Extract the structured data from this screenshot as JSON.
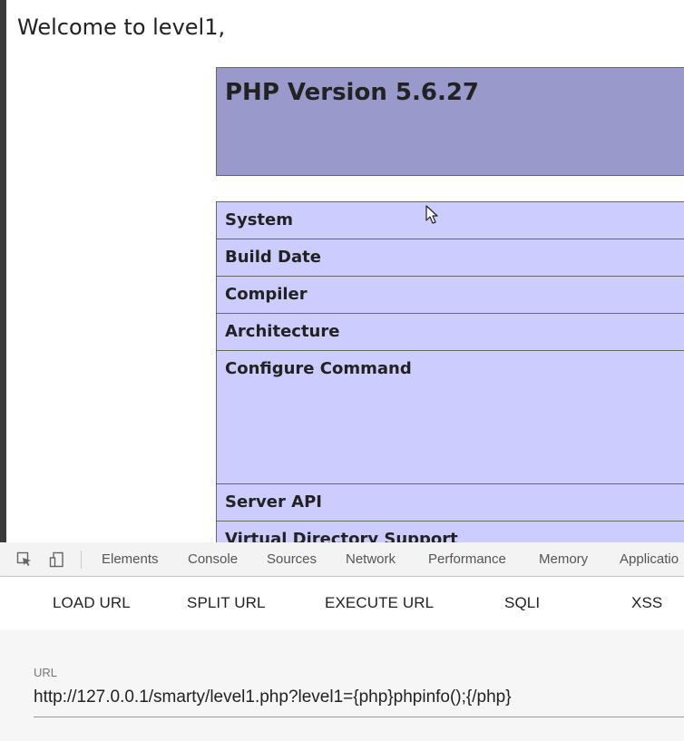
{
  "page": {
    "welcome": "Welcome to level1,",
    "php_title": "PHP Version 5.6.27",
    "info_rows": [
      "System",
      "Build Date",
      "Compiler",
      "Architecture",
      "Configure Command",
      "Server API",
      "Virtual Directory Support"
    ]
  },
  "devtools": {
    "tabs": [
      "Elements",
      "Console",
      "Sources",
      "Network",
      "Performance",
      "Memory",
      "Applicatio"
    ],
    "toolbar": [
      "LOAD URL",
      "SPLIT URL",
      "EXECUTE URL",
      "SQLI",
      "XSS"
    ],
    "url_label": "URL",
    "url_value": "http://127.0.0.1/smarty/level1.php?level1={php}phpinfo();{/php}"
  },
  "icons": {
    "inspect": "inspect-element-icon",
    "device": "device-toolbar-icon",
    "cursor": "mouse-cursor-icon"
  },
  "colors": {
    "php_header": "#9999cc",
    "php_row": "#ccccff"
  }
}
